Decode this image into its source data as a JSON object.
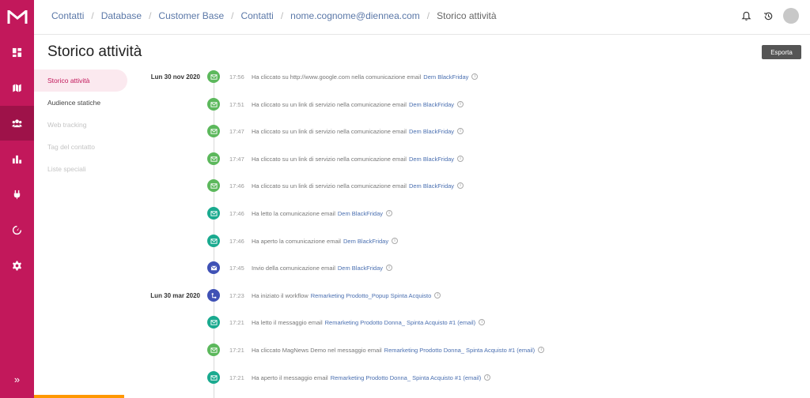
{
  "breadcrumb": [
    "Contatti",
    "Database",
    "Customer Base",
    "Contatti",
    "nome.cognome@diennea.com",
    "Storico attività"
  ],
  "page": {
    "title": "Storico attività",
    "export_label": "Esporta"
  },
  "subnav": [
    {
      "label": "Storico attività",
      "state": "active"
    },
    {
      "label": "Audience statiche",
      "state": "normal"
    },
    {
      "label": "Web tracking",
      "state": "disabled"
    },
    {
      "label": "Tag del contatto",
      "state": "disabled"
    },
    {
      "label": "Liste speciali",
      "state": "disabled"
    }
  ],
  "colors": {
    "brand": "#c2185b",
    "click": "#5cb85c",
    "read": "#1aaa8f",
    "send": "#3f51b5",
    "workflow": "#3f51b5"
  },
  "timeline": [
    {
      "date": "Lun 30 nov 2020",
      "time": "17:56",
      "type": "click",
      "icon": "mail-click-icon",
      "text": "Ha cliccato su http://www.google.com nella comunicazione email",
      "link": "Dem BlackFriday"
    },
    {
      "date": "",
      "time": "17:51",
      "type": "click",
      "icon": "mail-click-icon",
      "text": "Ha cliccato su un link di servizio nella comunicazione email",
      "link": "Dem BlackFriday"
    },
    {
      "date": "",
      "time": "17:47",
      "type": "click",
      "icon": "mail-click-icon",
      "text": "Ha cliccato su un link di servizio nella comunicazione email",
      "link": "Dem BlackFriday"
    },
    {
      "date": "",
      "time": "17:47",
      "type": "click",
      "icon": "mail-click-icon",
      "text": "Ha cliccato su un link di servizio nella comunicazione email",
      "link": "Dem BlackFriday"
    },
    {
      "date": "",
      "time": "17:46",
      "type": "click",
      "icon": "mail-click-icon",
      "text": "Ha cliccato su un link di servizio nella comunicazione email",
      "link": "Dem BlackFriday"
    },
    {
      "date": "",
      "time": "17:46",
      "type": "read",
      "icon": "mail-read-icon",
      "text": "Ha letto la comunicazione email",
      "link": "Dem BlackFriday"
    },
    {
      "date": "",
      "time": "17:46",
      "type": "read",
      "icon": "mail-open-icon",
      "text": "Ha aperto la comunicazione email",
      "link": "Dem BlackFriday"
    },
    {
      "date": "",
      "time": "17:45",
      "type": "send",
      "icon": "mail-send-icon",
      "text": "Invio della comunicazione email",
      "link": "Dem BlackFriday"
    },
    {
      "date": "Lun 30 mar 2020",
      "time": "17:23",
      "type": "workflow",
      "icon": "workflow-icon",
      "text": "Ha iniziato il workflow",
      "link": "Remarketing Prodotto_Popup Spinta Acquisto"
    },
    {
      "date": "",
      "time": "17:21",
      "type": "read",
      "icon": "mail-read-icon",
      "text": "Ha letto il messaggio email",
      "link": "Remarketing Prodotto Donna_ Spinta Acquisto #1 (email)"
    },
    {
      "date": "",
      "time": "17:21",
      "type": "click",
      "icon": "mail-click-icon",
      "text": "Ha cliccato MagNews Demo nel messaggio email",
      "link": "Remarketing Prodotto Donna_ Spinta Acquisto #1 (email)"
    },
    {
      "date": "",
      "time": "17:21",
      "type": "read",
      "icon": "mail-open-icon",
      "text": "Ha aperto il messaggio email",
      "link": "Remarketing Prodotto Donna_ Spinta Acquisto #1 (email)"
    }
  ]
}
